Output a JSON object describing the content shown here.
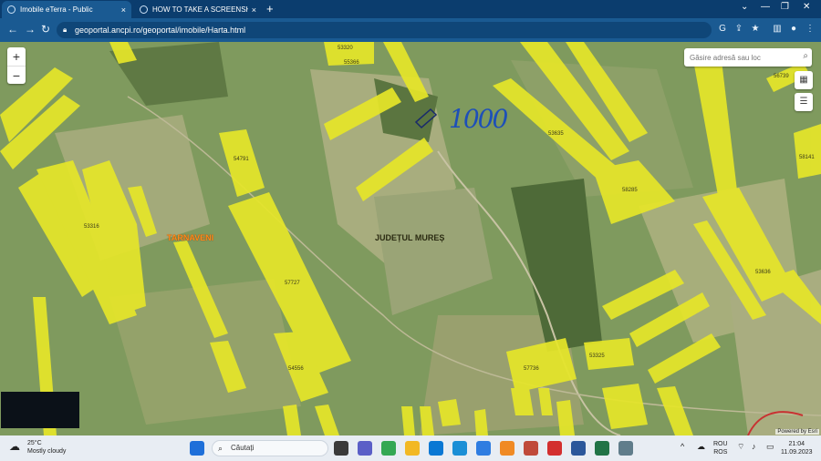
{
  "browser": {
    "tabs": [
      {
        "title": "Imobile eTerra - Public",
        "close": "×"
      },
      {
        "title": "HOW TO TAKE A SCREENSHOT O",
        "close": "×"
      }
    ],
    "new_tab": "+",
    "window_controls": [
      "⌄",
      "—",
      "❐",
      "✕"
    ],
    "url": "geoportal.ancpi.ro/geoportal/imobile/Harta.html",
    "nav": {
      "back": "←",
      "forward": "→",
      "reload": "↻"
    }
  },
  "map": {
    "zoom_in": "+",
    "zoom_out": "−",
    "search_placeholder": "Găsire adresă sau loc",
    "handwriting": "1000",
    "places": [
      {
        "text": "TARNAVENI",
        "color": "#ff8a1a"
      },
      {
        "text": "JUDEȚUL MUREȘ",
        "color": "#2b2b12"
      }
    ],
    "parcel_labels": [
      "53320",
      "55366",
      "53635",
      "54791",
      "53316",
      "58285",
      "57727",
      "53636",
      "54556",
      "57736",
      "53325",
      "56739",
      "58141"
    ],
    "attribution": "Powered by Esri",
    "colors": {
      "parcel": "#e6e629",
      "terrain": "#7f9a5e",
      "field": "#a8ad7e"
    }
  },
  "taskbar": {
    "weather_temp": "25°C",
    "weather_desc": "Mostly cloudy",
    "search_label": "Căutați",
    "lang_top": "ROU",
    "lang_bottom": "ROS",
    "time": "21:04",
    "date": "11.09.2023"
  }
}
